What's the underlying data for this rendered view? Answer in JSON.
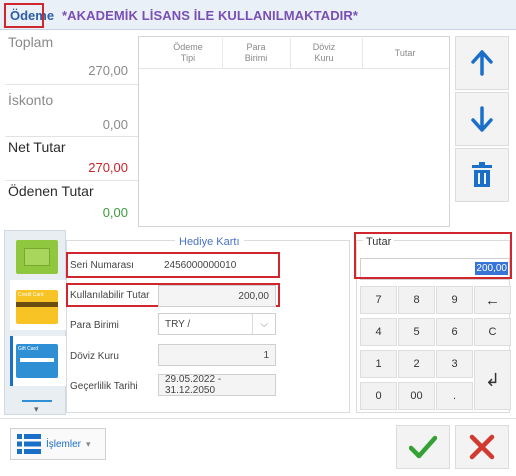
{
  "window": {
    "title": "Ödeme",
    "license_notice": "*AKADEMİK LİSANS İLE KULLANILMAKTADIR*"
  },
  "totals": {
    "toplam_label": "Toplam",
    "toplam_value": "270,00",
    "iskonto_label": "İskonto",
    "iskonto_value": "0,00",
    "net_label": "Net Tutar",
    "net_value": "270,00",
    "odenen_label": "Ödenen Tutar",
    "odenen_value": "0,00"
  },
  "grid": {
    "columns": [
      {
        "l1": "Ödeme",
        "l2": "Tipi"
      },
      {
        "l1": "Para",
        "l2": "Birimi"
      },
      {
        "l1": "Döviz",
        "l2": "Kuru"
      },
      {
        "l1": "Tutar",
        "l2": ""
      }
    ]
  },
  "side_buttons": {
    "up": "arrow-up-icon",
    "down": "arrow-down-icon",
    "delete": "trash-icon"
  },
  "gift_card": {
    "title": "Hediye Kartı",
    "seri_label": "Seri Numarası",
    "seri_value": "2456000000010",
    "kullanilabilir_label": "Kullanılabilir Tutar",
    "kullanilabilir_value": "200,00",
    "para_label": "Para Birimi",
    "para_value": "TRY /",
    "doviz_label": "Döviz Kuru",
    "doviz_value": "1",
    "gecerlilik_label": "Geçerlilik Tarihi",
    "gecerlilik_value": "29.05.2022 - 31.12.2050"
  },
  "categories": {
    "card_texts": [
      "Credit Card",
      "Gift Card"
    ]
  },
  "tutar": {
    "title": "Tutar",
    "value": "200,00"
  },
  "keypad": {
    "keys": [
      "7",
      "8",
      "9",
      "←",
      "4",
      "5",
      "6",
      "C",
      "1",
      "2",
      "3",
      "0",
      "00",
      "."
    ],
    "enter": "↲"
  },
  "bottom": {
    "islemler_label": "İşlemler"
  },
  "colors": {
    "accent_blue": "#1a6fc9",
    "highlight_red": "#d0272f",
    "ok_green": "#33a133",
    "cancel_red": "#d33a2f"
  }
}
